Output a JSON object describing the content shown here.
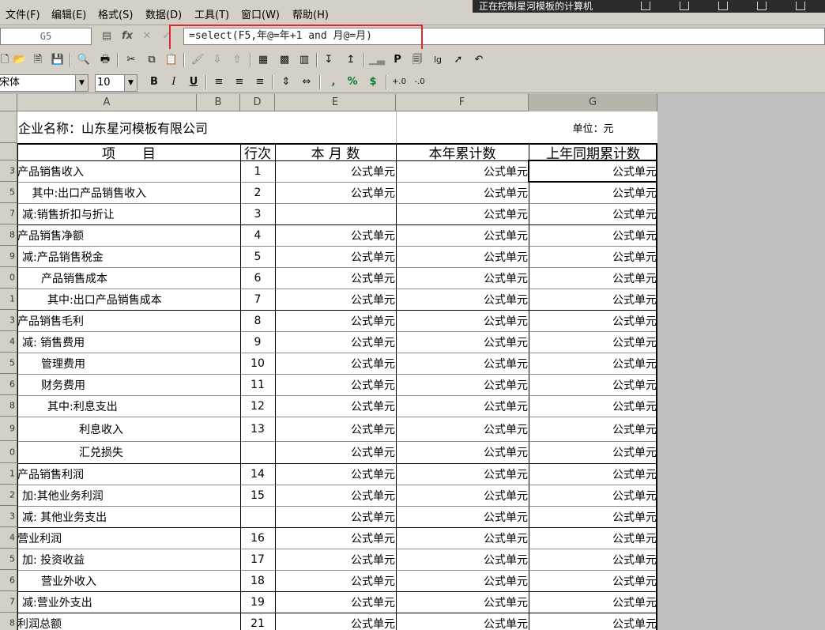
{
  "menu": [
    "文件(F)",
    "编辑(E)",
    "格式(S)",
    "数据(D)",
    "工具(T)",
    "窗口(W)",
    "帮助(H)"
  ],
  "remote_title": "正在控制星河模板的计算机",
  "formula_bar": {
    "cell_ref": "G5",
    "formula": "=select(F5,年@=年+1 and 月@=月)"
  },
  "format_bar": {
    "font_name": "宋体",
    "font_size": "10",
    "bold": "B",
    "italic": "I",
    "underline": "U",
    "comma": ",",
    "percent": "%",
    "currency": "$"
  },
  "columns": [
    "A",
    "B",
    "D",
    "E",
    "F",
    "G"
  ],
  "report": {
    "company": "企业名称：山东星河模板有限公司",
    "unit": "单位：元",
    "headers": {
      "item": "项　　目",
      "row_no": "行次",
      "this_month": "本 月 数",
      "ytd": "本年累计数",
      "last_year_ytd": "上年同期累计数"
    },
    "rows": [
      {
        "rh": "3",
        "item": "产品销售收入",
        "no": "1",
        "e": "公式单元",
        "f": "公式单元",
        "g": "公式单元"
      },
      {
        "rh": "5",
        "item": " 其中:出口产品销售收入",
        "no": "2",
        "e": "公式单元",
        "f": "公式单元",
        "g": "公式单元"
      },
      {
        "rh": "7",
        "item": "减:销售折扣与折让",
        "no": "3",
        "e": "",
        "f": "公式单元",
        "g": "公式单元"
      },
      {
        "rh": "8",
        "item": "产品销售净额",
        "no": "4",
        "e": "公式单元",
        "f": "公式单元",
        "g": "公式单元"
      },
      {
        "rh": "9",
        "item": "减:产品销售税金",
        "no": "5",
        "e": "公式单元",
        "f": "公式单元",
        "g": "公式单元"
      },
      {
        "rh": "0",
        "item": "产品销售成本",
        "no": "6",
        "e": "公式单元",
        "f": "公式单元",
        "g": "公式单元"
      },
      {
        "rh": "1",
        "item": "其中:出口产品销售成本",
        "no": "7",
        "e": "公式单元",
        "f": "公式单元",
        "g": "公式单元"
      },
      {
        "rh": "3",
        "item": "产品销售毛利",
        "no": "8",
        "e": "公式单元",
        "f": "公式单元",
        "g": "公式单元"
      },
      {
        "rh": "4",
        "item": "减: 销售费用",
        "no": "9",
        "e": "公式单元",
        "f": "公式单元",
        "g": "公式单元"
      },
      {
        "rh": "5",
        "item": "管理费用",
        "no": "10",
        "e": "公式单元",
        "f": "公式单元",
        "g": "公式单元"
      },
      {
        "rh": "6",
        "item": "财务费用",
        "no": "11",
        "e": "公式单元",
        "f": "公式单元",
        "g": "公式单元"
      },
      {
        "rh": "8",
        "item": "其中:利息支出",
        "no": "12",
        "e": "公式单元",
        "f": "公式单元",
        "g": "公式单元"
      },
      {
        "rh": "9",
        "item": "利息收入",
        "no": "13",
        "e": "公式单元",
        "f": "公式单元",
        "g": "公式单元"
      },
      {
        "rh": "0",
        "item": "汇兑损失",
        "no": "",
        "e": "公式单元",
        "f": "公式单元",
        "g": "公式单元"
      },
      {
        "rh": "1",
        "item": "产品销售利润",
        "no": "14",
        "e": "公式单元",
        "f": "公式单元",
        "g": "公式单元"
      },
      {
        "rh": "2",
        "item": "加:其他业务利润",
        "no": "15",
        "e": "公式单元",
        "f": "公式单元",
        "g": "公式单元"
      },
      {
        "rh": "3",
        "item": "减: 其他业务支出",
        "no": "",
        "e": "公式单元",
        "f": "公式单元",
        "g": "公式单元"
      },
      {
        "rh": "4",
        "item": "营业利润",
        "no": "16",
        "e": "公式单元",
        "f": "公式单元",
        "g": "公式单元"
      },
      {
        "rh": "5",
        "item": "加: 投资收益",
        "no": "17",
        "e": "公式单元",
        "f": "公式单元",
        "g": "公式单元"
      },
      {
        "rh": "6",
        "item": "营业外收入",
        "no": "18",
        "e": "公式单元",
        "f": "公式单元",
        "g": "公式单元"
      },
      {
        "rh": "7",
        "item": "减:营业外支出",
        "no": "19",
        "e": "公式单元",
        "f": "公式单元",
        "g": "公式单元"
      },
      {
        "rh": "8",
        "item": "利润总额",
        "no": "21",
        "e": "公式单元",
        "f": "公式单元",
        "g": "公式单元"
      }
    ]
  },
  "colors": {
    "highlight_box": "#e0282a",
    "toolbar": "#d4d0c8"
  }
}
